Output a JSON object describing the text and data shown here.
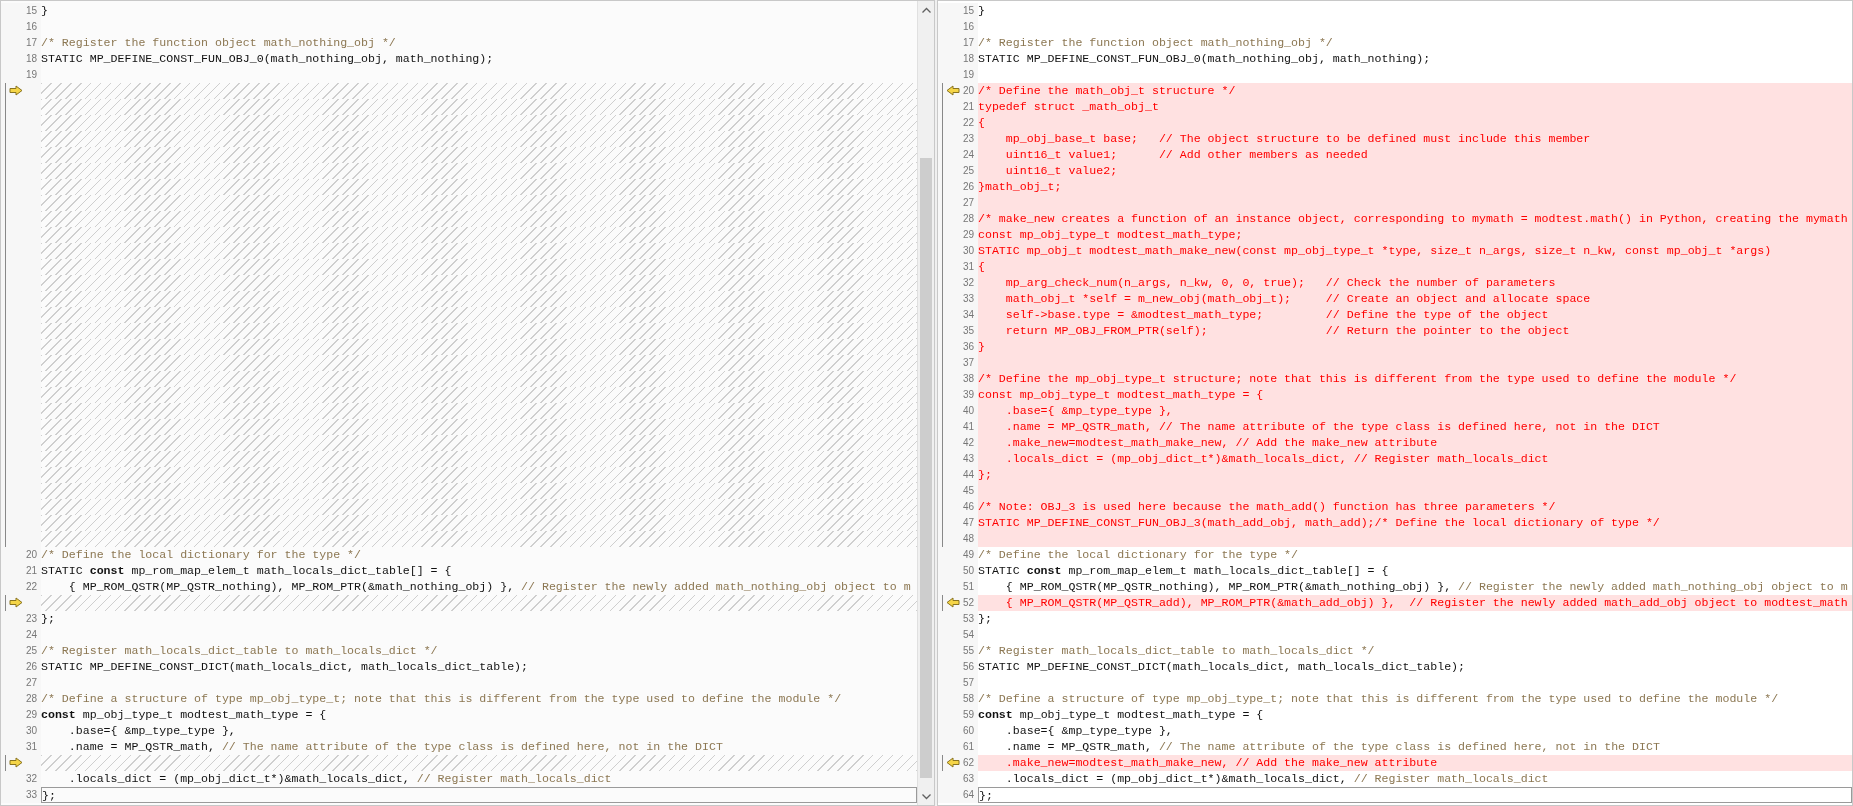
{
  "panes": [
    {
      "kind": "original",
      "rows": [
        {
          "kind": "line",
          "number": "15",
          "changed": false,
          "current": false,
          "marker": false,
          "parts": [
            {
              "kind": "code",
              "text": "}"
            }
          ]
        },
        {
          "kind": "line",
          "number": "16",
          "changed": false,
          "current": false,
          "marker": false,
          "parts": []
        },
        {
          "kind": "line",
          "number": "17",
          "changed": false,
          "current": false,
          "marker": false,
          "parts": [
            {
              "kind": "comment",
              "text": "/* Register the function object math_nothing_obj */"
            }
          ]
        },
        {
          "kind": "line",
          "number": "18",
          "changed": false,
          "current": false,
          "marker": false,
          "parts": [
            {
              "kind": "code",
              "text": "STATIC MP_DEFINE_CONST_FUN_OBJ_0(math_nothing_obj, math_nothing);"
            }
          ]
        },
        {
          "kind": "line",
          "number": "19",
          "changed": false,
          "current": false,
          "marker": false,
          "parts": []
        },
        {
          "kind": "filler",
          "marker": true
        },
        {
          "kind": "filler",
          "marker": false
        },
        {
          "kind": "filler",
          "marker": false
        },
        {
          "kind": "filler",
          "marker": false
        },
        {
          "kind": "filler",
          "marker": false
        },
        {
          "kind": "filler",
          "marker": false
        },
        {
          "kind": "filler",
          "marker": false
        },
        {
          "kind": "filler",
          "marker": false
        },
        {
          "kind": "filler",
          "marker": false
        },
        {
          "kind": "filler",
          "marker": false
        },
        {
          "kind": "filler",
          "marker": false
        },
        {
          "kind": "filler",
          "marker": false
        },
        {
          "kind": "filler",
          "marker": false
        },
        {
          "kind": "filler",
          "marker": false
        },
        {
          "kind": "filler",
          "marker": false
        },
        {
          "kind": "filler",
          "marker": false
        },
        {
          "kind": "filler",
          "marker": false
        },
        {
          "kind": "filler",
          "marker": false
        },
        {
          "kind": "filler",
          "marker": false
        },
        {
          "kind": "filler",
          "marker": false
        },
        {
          "kind": "filler",
          "marker": false
        },
        {
          "kind": "filler",
          "marker": false
        },
        {
          "kind": "filler",
          "marker": false
        },
        {
          "kind": "filler",
          "marker": false
        },
        {
          "kind": "filler",
          "marker": false
        },
        {
          "kind": "filler",
          "marker": false
        },
        {
          "kind": "filler",
          "marker": false
        },
        {
          "kind": "filler",
          "marker": false
        },
        {
          "kind": "filler",
          "marker": false
        },
        {
          "kind": "line",
          "number": "20",
          "changed": false,
          "current": false,
          "marker": false,
          "parts": [
            {
              "kind": "comment",
              "text": "/* Define the local dictionary for the type */"
            }
          ]
        },
        {
          "kind": "line",
          "number": "21",
          "changed": false,
          "current": false,
          "marker": false,
          "parts": [
            {
              "kind": "code",
              "text": "STATIC "
            },
            {
              "kind": "keyword",
              "text": "const"
            },
            {
              "kind": "code",
              "text": " mp_rom_map_elem_t math_locals_dict_table[] = {"
            }
          ]
        },
        {
          "kind": "line",
          "number": "22",
          "changed": false,
          "current": false,
          "marker": false,
          "parts": [
            {
              "kind": "code",
              "text": "    { MP_ROM_QSTR(MP_QSTR_nothing), MP_ROM_PTR(&math_nothing_obj) }, "
            },
            {
              "kind": "comment",
              "text": "// Register the newly added math_nothing_obj object to m"
            }
          ]
        },
        {
          "kind": "filler",
          "marker": true
        },
        {
          "kind": "line",
          "number": "23",
          "changed": false,
          "current": false,
          "marker": false,
          "parts": [
            {
              "kind": "code",
              "text": "};"
            }
          ]
        },
        {
          "kind": "line",
          "number": "24",
          "changed": false,
          "current": false,
          "marker": false,
          "parts": []
        },
        {
          "kind": "line",
          "number": "25",
          "changed": false,
          "current": false,
          "marker": false,
          "parts": [
            {
              "kind": "comment",
              "text": "/* Register math_locals_dict_table to math_locals_dict */"
            }
          ]
        },
        {
          "kind": "line",
          "number": "26",
          "changed": false,
          "current": false,
          "marker": false,
          "parts": [
            {
              "kind": "code",
              "text": "STATIC MP_DEFINE_CONST_DICT(math_locals_dict, math_locals_dict_table);"
            }
          ]
        },
        {
          "kind": "line",
          "number": "27",
          "changed": false,
          "current": false,
          "marker": false,
          "parts": []
        },
        {
          "kind": "line",
          "number": "28",
          "changed": false,
          "current": false,
          "marker": false,
          "parts": [
            {
              "kind": "comment",
              "text": "/* Define a structure of type mp_obj_type_t; note that this is different from the type used to define the module */"
            }
          ]
        },
        {
          "kind": "line",
          "number": "29",
          "changed": false,
          "current": false,
          "marker": false,
          "parts": [
            {
              "kind": "keyword",
              "text": "const"
            },
            {
              "kind": "code",
              "text": " mp_obj_type_t modtest_math_type = {"
            }
          ]
        },
        {
          "kind": "line",
          "number": "30",
          "changed": false,
          "current": false,
          "marker": false,
          "parts": [
            {
              "kind": "code",
              "text": "    .base={ &mp_type_type },"
            }
          ]
        },
        {
          "kind": "line",
          "number": "31",
          "changed": false,
          "current": false,
          "marker": false,
          "parts": [
            {
              "kind": "code",
              "text": "    .name = MP_QSTR_math, "
            },
            {
              "kind": "comment",
              "text": "// The name attribute of the type class is defined here, not in the DICT"
            }
          ]
        },
        {
          "kind": "filler",
          "marker": true
        },
        {
          "kind": "line",
          "number": "32",
          "changed": false,
          "current": false,
          "marker": false,
          "parts": [
            {
              "kind": "code",
              "text": "    .locals_dict = (mp_obj_dict_t*)&math_locals_dict, "
            },
            {
              "kind": "comment",
              "text": "// Register math_locals_dict"
            }
          ]
        },
        {
          "kind": "line",
          "number": "33",
          "changed": false,
          "current": true,
          "marker": false,
          "parts": [
            {
              "kind": "code",
              "text": "};"
            }
          ]
        }
      ]
    },
    {
      "kind": "modified",
      "rows": [
        {
          "kind": "line",
          "number": "15",
          "changed": false,
          "current": false,
          "marker": false,
          "parts": [
            {
              "kind": "code",
              "text": "}"
            }
          ]
        },
        {
          "kind": "line",
          "number": "16",
          "changed": false,
          "current": false,
          "marker": false,
          "parts": []
        },
        {
          "kind": "line",
          "number": "17",
          "changed": false,
          "current": false,
          "marker": false,
          "parts": [
            {
              "kind": "comment",
              "text": "/* Register the function object math_nothing_obj */"
            }
          ]
        },
        {
          "kind": "line",
          "number": "18",
          "changed": false,
          "current": false,
          "marker": false,
          "parts": [
            {
              "kind": "code",
              "text": "STATIC MP_DEFINE_CONST_FUN_OBJ_0(math_nothing_obj, math_nothing);"
            }
          ]
        },
        {
          "kind": "line",
          "number": "19",
          "changed": false,
          "current": false,
          "marker": false,
          "parts": []
        },
        {
          "kind": "line",
          "number": "20",
          "changed": true,
          "current": false,
          "marker": true,
          "parts": [
            {
              "kind": "code",
              "text": "/* Define the math_obj_t structure */"
            }
          ]
        },
        {
          "kind": "line",
          "number": "21",
          "changed": true,
          "current": false,
          "marker": false,
          "parts": [
            {
              "kind": "code",
              "text": "typedef struct _math_obj_t"
            }
          ]
        },
        {
          "kind": "line",
          "number": "22",
          "changed": true,
          "current": false,
          "marker": false,
          "parts": [
            {
              "kind": "code",
              "text": "{"
            }
          ]
        },
        {
          "kind": "line",
          "number": "23",
          "changed": true,
          "current": false,
          "marker": false,
          "parts": [
            {
              "kind": "code",
              "text": "    mp_obj_base_t base;   // The object structure to be defined must include this member"
            }
          ]
        },
        {
          "kind": "line",
          "number": "24",
          "changed": true,
          "current": false,
          "marker": false,
          "parts": [
            {
              "kind": "code",
              "text": "    uint16_t value1;      // Add other members as needed"
            }
          ]
        },
        {
          "kind": "line",
          "number": "25",
          "changed": true,
          "current": false,
          "marker": false,
          "parts": [
            {
              "kind": "code",
              "text": "    uint16_t value2;"
            }
          ]
        },
        {
          "kind": "line",
          "number": "26",
          "changed": true,
          "current": false,
          "marker": false,
          "parts": [
            {
              "kind": "code",
              "text": "}math_obj_t;"
            }
          ]
        },
        {
          "kind": "line",
          "number": "27",
          "changed": true,
          "current": false,
          "marker": false,
          "parts": []
        },
        {
          "kind": "line",
          "number": "28",
          "changed": true,
          "current": false,
          "marker": false,
          "parts": [
            {
              "kind": "code",
              "text": "/* make_new creates a function of an instance object, corresponding to mymath = modtest.math() in Python, creating the mymath"
            }
          ]
        },
        {
          "kind": "line",
          "number": "29",
          "changed": true,
          "current": false,
          "marker": false,
          "parts": [
            {
              "kind": "code",
              "text": "const mp_obj_type_t modtest_math_type;"
            }
          ]
        },
        {
          "kind": "line",
          "number": "30",
          "changed": true,
          "current": false,
          "marker": false,
          "parts": [
            {
              "kind": "code",
              "text": "STATIC mp_obj_t modtest_math_make_new(const mp_obj_type_t *type, size_t n_args, size_t n_kw, const mp_obj_t *args)"
            }
          ]
        },
        {
          "kind": "line",
          "number": "31",
          "changed": true,
          "current": false,
          "marker": false,
          "parts": [
            {
              "kind": "code",
              "text": "{"
            }
          ]
        },
        {
          "kind": "line",
          "number": "32",
          "changed": true,
          "current": false,
          "marker": false,
          "parts": [
            {
              "kind": "code",
              "text": "    mp_arg_check_num(n_args, n_kw, 0, 0, true);   // Check the number of parameters"
            }
          ]
        },
        {
          "kind": "line",
          "number": "33",
          "changed": true,
          "current": false,
          "marker": false,
          "parts": [
            {
              "kind": "code",
              "text": "    math_obj_t *self = m_new_obj(math_obj_t);     // Create an object and allocate space"
            }
          ]
        },
        {
          "kind": "line",
          "number": "34",
          "changed": true,
          "current": false,
          "marker": false,
          "parts": [
            {
              "kind": "code",
              "text": "    self->base.type = &modtest_math_type;         // Define the type of the object"
            }
          ]
        },
        {
          "kind": "line",
          "number": "35",
          "changed": true,
          "current": false,
          "marker": false,
          "parts": [
            {
              "kind": "code",
              "text": "    return MP_OBJ_FROM_PTR(self);                 // Return the pointer to the object"
            }
          ]
        },
        {
          "kind": "line",
          "number": "36",
          "changed": true,
          "current": false,
          "marker": false,
          "parts": [
            {
              "kind": "code",
              "text": "}"
            }
          ]
        },
        {
          "kind": "line",
          "number": "37",
          "changed": true,
          "current": false,
          "marker": false,
          "parts": []
        },
        {
          "kind": "line",
          "number": "38",
          "changed": true,
          "current": false,
          "marker": false,
          "parts": [
            {
              "kind": "code",
              "text": "/* Define the mp_obj_type_t structure; note that this is different from the type used to define the module */"
            }
          ]
        },
        {
          "kind": "line",
          "number": "39",
          "changed": true,
          "current": false,
          "marker": false,
          "parts": [
            {
              "kind": "code",
              "text": "const mp_obj_type_t modtest_math_type = {"
            }
          ]
        },
        {
          "kind": "line",
          "number": "40",
          "changed": true,
          "current": false,
          "marker": false,
          "parts": [
            {
              "kind": "code",
              "text": "    .base={ &mp_type_type },"
            }
          ]
        },
        {
          "kind": "line",
          "number": "41",
          "changed": true,
          "current": false,
          "marker": false,
          "parts": [
            {
              "kind": "code",
              "text": "    .name = MP_QSTR_math, // The name attribute of the type class is defined here, not in the DICT"
            }
          ]
        },
        {
          "kind": "line",
          "number": "42",
          "changed": true,
          "current": false,
          "marker": false,
          "parts": [
            {
              "kind": "code",
              "text": "    .make_new=modtest_math_make_new, // Add the make_new attribute"
            }
          ]
        },
        {
          "kind": "line",
          "number": "43",
          "changed": true,
          "current": false,
          "marker": false,
          "parts": [
            {
              "kind": "code",
              "text": "    .locals_dict = (mp_obj_dict_t*)&math_locals_dict, // Register math_locals_dict"
            }
          ]
        },
        {
          "kind": "line",
          "number": "44",
          "changed": true,
          "current": false,
          "marker": false,
          "parts": [
            {
              "kind": "code",
              "text": "};"
            }
          ]
        },
        {
          "kind": "line",
          "number": "45",
          "changed": true,
          "current": false,
          "marker": false,
          "parts": []
        },
        {
          "kind": "line",
          "number": "46",
          "changed": true,
          "current": false,
          "marker": false,
          "parts": [
            {
              "kind": "code",
              "text": "/* Note: OBJ_3 is used here because the math_add() function has three parameters */"
            }
          ]
        },
        {
          "kind": "line",
          "number": "47",
          "changed": true,
          "current": false,
          "marker": false,
          "parts": [
            {
              "kind": "code",
              "text": "STATIC MP_DEFINE_CONST_FUN_OBJ_3(math_add_obj, math_add);/* Define the local dictionary of type */"
            }
          ]
        },
        {
          "kind": "line",
          "number": "48",
          "changed": true,
          "current": false,
          "marker": false,
          "parts": []
        },
        {
          "kind": "line",
          "number": "49",
          "changed": false,
          "current": false,
          "marker": false,
          "parts": [
            {
              "kind": "comment",
              "text": "/* Define the local dictionary for the type */"
            }
          ]
        },
        {
          "kind": "line",
          "number": "50",
          "changed": false,
          "current": false,
          "marker": false,
          "parts": [
            {
              "kind": "code",
              "text": "STATIC "
            },
            {
              "kind": "keyword",
              "text": "const"
            },
            {
              "kind": "code",
              "text": " mp_rom_map_elem_t math_locals_dict_table[] = {"
            }
          ]
        },
        {
          "kind": "line",
          "number": "51",
          "changed": false,
          "current": false,
          "marker": false,
          "parts": [
            {
              "kind": "code",
              "text": "    { MP_ROM_QSTR(MP_QSTR_nothing), MP_ROM_PTR(&math_nothing_obj) }, "
            },
            {
              "kind": "comment",
              "text": "// Register the newly added math_nothing_obj object to m"
            }
          ]
        },
        {
          "kind": "line",
          "number": "52",
          "changed": true,
          "current": false,
          "marker": true,
          "parts": [
            {
              "kind": "code",
              "text": "    { MP_ROM_QSTR(MP_QSTR_add), MP_ROM_PTR(&math_add_obj) },  // Register the newly added math_add_obj object to modtest_math"
            }
          ]
        },
        {
          "kind": "line",
          "number": "53",
          "changed": false,
          "current": false,
          "marker": false,
          "parts": [
            {
              "kind": "code",
              "text": "};"
            }
          ]
        },
        {
          "kind": "line",
          "number": "54",
          "changed": false,
          "current": false,
          "marker": false,
          "parts": []
        },
        {
          "kind": "line",
          "number": "55",
          "changed": false,
          "current": false,
          "marker": false,
          "parts": [
            {
              "kind": "comment",
              "text": "/* Register math_locals_dict_table to math_locals_dict */"
            }
          ]
        },
        {
          "kind": "line",
          "number": "56",
          "changed": false,
          "current": false,
          "marker": false,
          "parts": [
            {
              "kind": "code",
              "text": "STATIC MP_DEFINE_CONST_DICT(math_locals_dict, math_locals_dict_table);"
            }
          ]
        },
        {
          "kind": "line",
          "number": "57",
          "changed": false,
          "current": false,
          "marker": false,
          "parts": []
        },
        {
          "kind": "line",
          "number": "58",
          "changed": false,
          "current": false,
          "marker": false,
          "parts": [
            {
              "kind": "comment",
              "text": "/* Define a structure of type mp_obj_type_t; note that this is different from the type used to define the module */"
            }
          ]
        },
        {
          "kind": "line",
          "number": "59",
          "changed": false,
          "current": false,
          "marker": false,
          "parts": [
            {
              "kind": "keyword",
              "text": "const"
            },
            {
              "kind": "code",
              "text": " mp_obj_type_t modtest_math_type = {"
            }
          ]
        },
        {
          "kind": "line",
          "number": "60",
          "changed": false,
          "current": false,
          "marker": false,
          "parts": [
            {
              "kind": "code",
              "text": "    .base={ &mp_type_type },"
            }
          ]
        },
        {
          "kind": "line",
          "number": "61",
          "changed": false,
          "current": false,
          "marker": false,
          "parts": [
            {
              "kind": "code",
              "text": "    .name = MP_QSTR_math, "
            },
            {
              "kind": "comment",
              "text": "// The name attribute of the type class is defined here, not in the DICT"
            }
          ]
        },
        {
          "kind": "line",
          "number": "62",
          "changed": true,
          "current": false,
          "marker": true,
          "parts": [
            {
              "kind": "code",
              "text": "    .make_new=modtest_math_make_new, // Add the make_new attribute"
            }
          ]
        },
        {
          "kind": "line",
          "number": "63",
          "changed": false,
          "current": false,
          "marker": false,
          "parts": [
            {
              "kind": "code",
              "text": "    .locals_dict = (mp_obj_dict_t*)&math_locals_dict, "
            },
            {
              "kind": "comment",
              "text": "// Register math_locals_dict"
            }
          ]
        },
        {
          "kind": "line",
          "number": "64",
          "changed": false,
          "current": true,
          "marker": false,
          "parts": [
            {
              "kind": "code",
              "text": "};"
            }
          ]
        }
      ]
    }
  ]
}
